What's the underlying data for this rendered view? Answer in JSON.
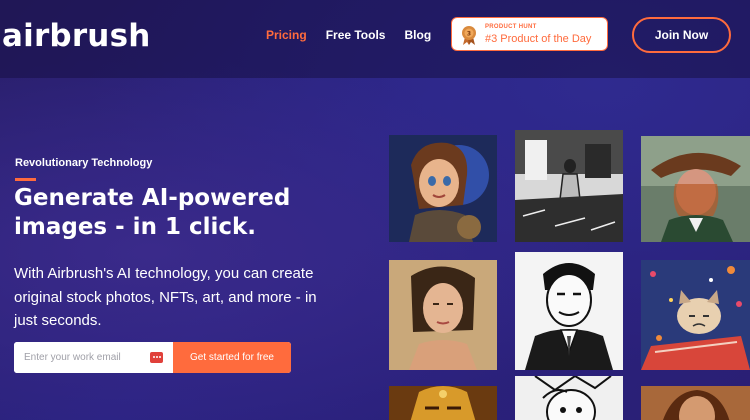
{
  "header": {
    "logo": "airbrush",
    "nav": [
      {
        "label": "Pricing",
        "active": true
      },
      {
        "label": "Free Tools",
        "active": false
      },
      {
        "label": "Blog",
        "active": false
      }
    ],
    "badge": {
      "small": "PRODUCT HUNT",
      "big": "#3 Product of the Day",
      "icon": "medal-icon"
    },
    "join_label": "Join Now"
  },
  "hero": {
    "eyebrow": "Revolutionary Technology",
    "headline": "Generate AI-powered images - in 1 click.",
    "subtext": "With Airbrush's AI technology, you can create original stock photos, NFTs, art, and more - in just seconds.",
    "email_placeholder": "Enter your work email",
    "cta_label": "Get started for free"
  },
  "gallery": {
    "tiles": [
      {
        "name": "gallery-image-cartoon-heroine"
      },
      {
        "name": "gallery-image-sketch-room"
      },
      {
        "name": "gallery-image-woman-hat"
      },
      {
        "name": "gallery-image-portrait-woman"
      },
      {
        "name": "gallery-image-sketch-man-suit"
      },
      {
        "name": "gallery-image-grumpy-cat"
      },
      {
        "name": "gallery-image-golden-mask"
      },
      {
        "name": "gallery-image-comic-face"
      },
      {
        "name": "gallery-image-warm-portrait"
      }
    ]
  },
  "colors": {
    "accent": "#ff6b3d",
    "background": "#2b2383",
    "text": "#ffffff"
  }
}
